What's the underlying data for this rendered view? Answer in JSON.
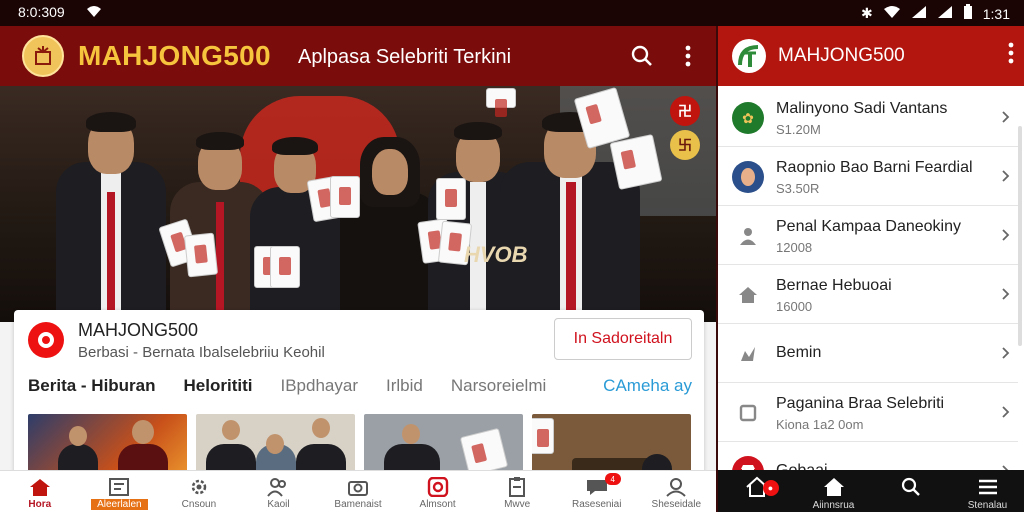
{
  "status_bar": {
    "time": "8:0:309",
    "right_time": "1:31"
  },
  "app": {
    "brand": "MAHJONG500",
    "subtitle": "Aplpasa Selebriti Terkini"
  },
  "hero": {
    "watermark": "HVOB"
  },
  "info_card": {
    "name": "MAHJONG500",
    "desc": "Berbasi - Bernata Ibalselebriiu Keohil",
    "action_label": "In Sadoreitaln",
    "tabs": [
      "Berita - Hiburan",
      "Helorititi",
      "IBpdhayar",
      "Irlbid",
      "Narsoreielmi",
      "CAmeha ay"
    ]
  },
  "bottom_nav": [
    {
      "label": "Hora",
      "icon": "home-icon"
    },
    {
      "label": "Aleerlalen",
      "icon": "news-icon"
    },
    {
      "label": "Cnsoun",
      "icon": "gear-icon"
    },
    {
      "label": "Kaoil",
      "icon": "people-icon"
    },
    {
      "label": "Bamenaist",
      "icon": "camera-icon"
    },
    {
      "label": "Almsont",
      "icon": "instagram-icon"
    },
    {
      "label": "Mwve",
      "icon": "clipboard-icon"
    },
    {
      "label": "Raseseniai",
      "icon": "chat-icon",
      "badge": "4"
    },
    {
      "label": "Sheseidale",
      "icon": "profile-icon"
    }
  ],
  "side": {
    "title": "MAHJONG500",
    "items": [
      {
        "title": "Malinyono Sadi Vantans",
        "sub": "S1.20M",
        "icon": "plant-icon",
        "color": "#1f7a2c"
      },
      {
        "title": "Raopnio Bao Barni Feardial",
        "sub": "S3.50R",
        "icon": "avatar-icon",
        "color": "#2a4f8a"
      },
      {
        "title": "Penal Kampaa Daneokiny",
        "sub": "12008",
        "icon": "person-icon",
        "color": "#888888"
      },
      {
        "title": "Bernae Hebuoai",
        "sub": "16000",
        "icon": "home-icon",
        "color": "#888888"
      },
      {
        "title": "Bemin",
        "sub": "",
        "icon": "star-icon",
        "color": "#888888"
      },
      {
        "title": "Paganina Braa Selebriti",
        "sub": "Kiona 1a2 0om",
        "icon": "tablet-icon",
        "color": "#888888"
      },
      {
        "title": "Gobaai",
        "sub": "",
        "icon": "store-icon",
        "color": "#d0121e"
      }
    ],
    "nav": [
      {
        "label": "",
        "icon": "home-icon",
        "badge": "●"
      },
      {
        "label": "Aiinnsrua",
        "icon": "home-icon"
      },
      {
        "label": "",
        "icon": "search-icon"
      },
      {
        "label": "Stenalau",
        "icon": "menu-icon"
      }
    ]
  },
  "colors": {
    "brand": "#7b0c0c",
    "accent": "#b3150f",
    "gold": "#f6c53d"
  }
}
